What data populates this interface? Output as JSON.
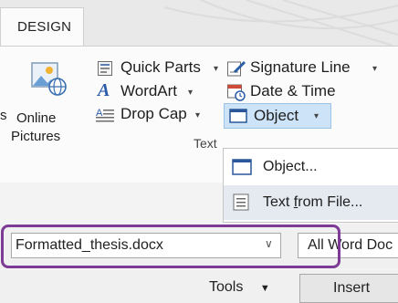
{
  "ribbon": {
    "tab_label": "DESIGN",
    "left_cut_label": "s",
    "online_pictures": {
      "line1": "Online",
      "line2": "Pictures",
      "icon": "online-pictures-icon"
    },
    "items": {
      "quick_parts": "Quick Parts",
      "wordart": "WordArt",
      "drop_cap": "Drop Cap",
      "signature_line": "Signature Line",
      "date_time": "Date & Time",
      "object": "Object"
    },
    "group_label": "Text"
  },
  "object_menu": {
    "items": [
      {
        "label_pre": "Object...",
        "label_u": "",
        "label_post": "",
        "icon": "object-window-icon"
      },
      {
        "label_pre": "Text ",
        "label_u": "f",
        "label_post": "rom File...",
        "icon": "text-file-icon"
      }
    ]
  },
  "dialog": {
    "file_name": "Formatted_thesis.docx",
    "file_type": "All Word Doc",
    "tools_label": "Tools",
    "insert_label": "Insert"
  },
  "colors": {
    "highlight": "#7d3b96",
    "accent": "#2b579a",
    "object_selected": "#cde3f7"
  }
}
